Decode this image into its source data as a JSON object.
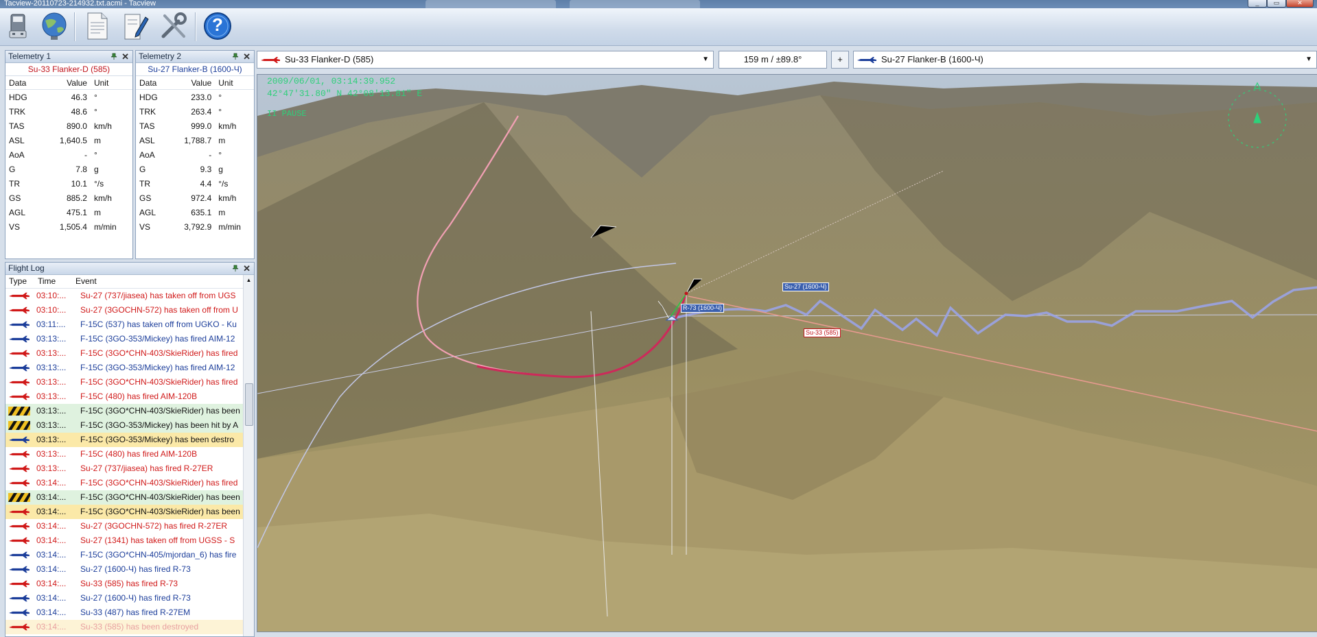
{
  "window": {
    "title": "Tacview-20110723-214932.txt.acmi - Tacview"
  },
  "toolbar": {
    "buttons": [
      {
        "icon": "usb-drive-icon"
      },
      {
        "icon": "globe-icon"
      },
      {
        "icon": "document-icon"
      },
      {
        "icon": "edit-icon"
      },
      {
        "icon": "tools-icon"
      },
      {
        "icon": "help-icon",
        "label": "?"
      }
    ]
  },
  "telemetry1": {
    "header": "Telemetry 1",
    "aircraft": "Su-33 Flanker-D (585)",
    "columns": [
      "Data",
      "Value",
      "Unit"
    ],
    "rows": [
      [
        "HDG",
        "46.3",
        "°"
      ],
      [
        "TRK",
        "48.6",
        "°"
      ],
      [
        "TAS",
        "890.0",
        "km/h"
      ],
      [
        "ASL",
        "1,640.5",
        "m"
      ],
      [
        "AoA",
        "-",
        "°"
      ],
      [
        "G",
        "7.8",
        "g"
      ],
      [
        "TR",
        "10.1",
        "°/s"
      ],
      [
        "GS",
        "885.2",
        "km/h"
      ],
      [
        "AGL",
        "475.1",
        "m"
      ],
      [
        "VS",
        "1,505.4",
        "m/min"
      ]
    ]
  },
  "telemetry2": {
    "header": "Telemetry 2",
    "aircraft": "Su-27 Flanker-B (1600-Ч)",
    "columns": [
      "Data",
      "Value",
      "Unit"
    ],
    "rows": [
      [
        "HDG",
        "233.0",
        "°"
      ],
      [
        "TRK",
        "263.4",
        "°"
      ],
      [
        "TAS",
        "999.0",
        "km/h"
      ],
      [
        "ASL",
        "1,788.7",
        "m"
      ],
      [
        "AoA",
        "-",
        "°"
      ],
      [
        "G",
        "9.3",
        "g"
      ],
      [
        "TR",
        "4.4",
        "°/s"
      ],
      [
        "GS",
        "972.4",
        "km/h"
      ],
      [
        "AGL",
        "635.1",
        "m"
      ],
      [
        "VS",
        "3,792.9",
        "m/min"
      ]
    ]
  },
  "flight_log": {
    "header": "Flight Log",
    "columns": [
      "Type",
      "Time",
      "Event"
    ],
    "rows": [
      {
        "icon": "red-plane-icon",
        "time": "03:10:...",
        "event": "Su-27 (737/jiasea) has taken off from UGS",
        "color": "#d01818",
        "bg": ""
      },
      {
        "icon": "red-plane-icon",
        "time": "03:10:...",
        "event": "Su-27 (3GOCHN-572) has taken off from U",
        "color": "#d01818",
        "bg": ""
      },
      {
        "icon": "blue-plane-icon",
        "time": "03:11:...",
        "event": "F-15C (537) has taken off from UGKO - Ku",
        "color": "#1b3d9a",
        "bg": ""
      },
      {
        "icon": "blue-plane-icon",
        "time": "03:13:...",
        "event": "F-15C (3GO-353/Mickey) has fired AIM-12",
        "color": "#1b3d9a",
        "bg": ""
      },
      {
        "icon": "red-plane-icon",
        "time": "03:13:...",
        "event": "F-15C (3GO*CHN-403/SkieRider) has fired",
        "color": "#d01818",
        "bg": ""
      },
      {
        "icon": "blue-plane-icon",
        "time": "03:13:...",
        "event": "F-15C (3GO-353/Mickey) has fired AIM-12",
        "color": "#1b3d9a",
        "bg": ""
      },
      {
        "icon": "red-plane-icon",
        "time": "03:13:...",
        "event": "F-15C (3GO*CHN-403/SkieRider) has fired",
        "color": "#d01818",
        "bg": ""
      },
      {
        "icon": "red-plane-icon",
        "time": "03:13:...",
        "event": "F-15C (480) has fired AIM-120B",
        "color": "#d01818",
        "bg": ""
      },
      {
        "icon": "hazard-stripe-icon",
        "time": "03:13:...",
        "event": "F-15C (3GO*CHN-403/SkieRider) has been",
        "color": "#111111",
        "bg": "#dff2df"
      },
      {
        "icon": "hazard-stripe-icon",
        "time": "03:13:...",
        "event": "F-15C (3GO-353/Mickey) has been hit by A",
        "color": "#111111",
        "bg": "#dff2df"
      },
      {
        "icon": "blue-plane-icon",
        "time": "03:13:...",
        "event": "F-15C (3GO-353/Mickey) has been destro",
        "color": "#111111",
        "bg": "#fbe9a8"
      },
      {
        "icon": "red-plane-icon",
        "time": "03:13:...",
        "event": "F-15C (480) has fired AIM-120B",
        "color": "#d01818",
        "bg": ""
      },
      {
        "icon": "red-plane-icon",
        "time": "03:13:...",
        "event": "Su-27 (737/jiasea) has fired R-27ER",
        "color": "#d01818",
        "bg": ""
      },
      {
        "icon": "red-plane-icon",
        "time": "03:14:...",
        "event": "F-15C (3GO*CHN-403/SkieRider) has fired",
        "color": "#d01818",
        "bg": ""
      },
      {
        "icon": "hazard-stripe-icon",
        "time": "03:14:...",
        "event": "F-15C (3GO*CHN-403/SkieRider) has been",
        "color": "#111111",
        "bg": "#dff2df"
      },
      {
        "icon": "red-plane-icon",
        "time": "03:14:...",
        "event": "F-15C (3GO*CHN-403/SkieRider) has been",
        "color": "#111111",
        "bg": "#fbe9a8"
      },
      {
        "icon": "red-plane-icon",
        "time": "03:14:...",
        "event": "Su-27 (3GOCHN-572) has fired R-27ER",
        "color": "#d01818",
        "bg": ""
      },
      {
        "icon": "red-plane-icon",
        "time": "03:14:...",
        "event": "Su-27 (1341) has taken off from UGSS - S",
        "color": "#d01818",
        "bg": ""
      },
      {
        "icon": "blue-plane-icon",
        "time": "03:14:...",
        "event": "F-15C (3GO*CHN-405/mjordan_6) has fire",
        "color": "#1b3d9a",
        "bg": ""
      },
      {
        "icon": "blue-plane-icon",
        "time": "03:14:...",
        "event": "Su-27 (1600-Ч) has fired R-73",
        "color": "#1b3d9a",
        "bg": ""
      },
      {
        "icon": "red-plane-icon",
        "time": "03:14:...",
        "event": "Su-33 (585) has fired R-73",
        "color": "#d01818",
        "bg": ""
      },
      {
        "icon": "blue-plane-icon",
        "time": "03:14:...",
        "event": "Su-27 (1600-Ч) has fired R-73",
        "color": "#1b3d9a",
        "bg": ""
      },
      {
        "icon": "blue-plane-icon",
        "time": "03:14:...",
        "event": "Su-33 (487) has fired R-27EM",
        "color": "#1b3d9a",
        "bg": ""
      },
      {
        "icon": "red-plane-icon",
        "time": "03:14:...",
        "event": "Su-33 (585) has been destroyed",
        "color": "#e8a0a0",
        "bg": "#fdf3d6"
      }
    ]
  },
  "view_bar": {
    "left_aircraft": "Su-33 Flanker-D (585)",
    "distance": "159 m / ±89.8°",
    "plus_label": "+",
    "right_aircraft": "Su-27 Flanker-B (1600-Ч)"
  },
  "view3d": {
    "datetime": "2009/06/01, 03:14:39.952",
    "coords": "42°47'31.80\" N  42°08'13.81\" E",
    "status": "II PAUSE",
    "labels": {
      "r73": "R-73 (1600-Ч)",
      "su27": "Su-27 (1600-Ч)",
      "su33": "Su-33 (585)"
    }
  },
  "colors": {
    "red_team": "#d01818",
    "blue_team": "#1b3d9a",
    "hud_green": "#2ed07a"
  }
}
